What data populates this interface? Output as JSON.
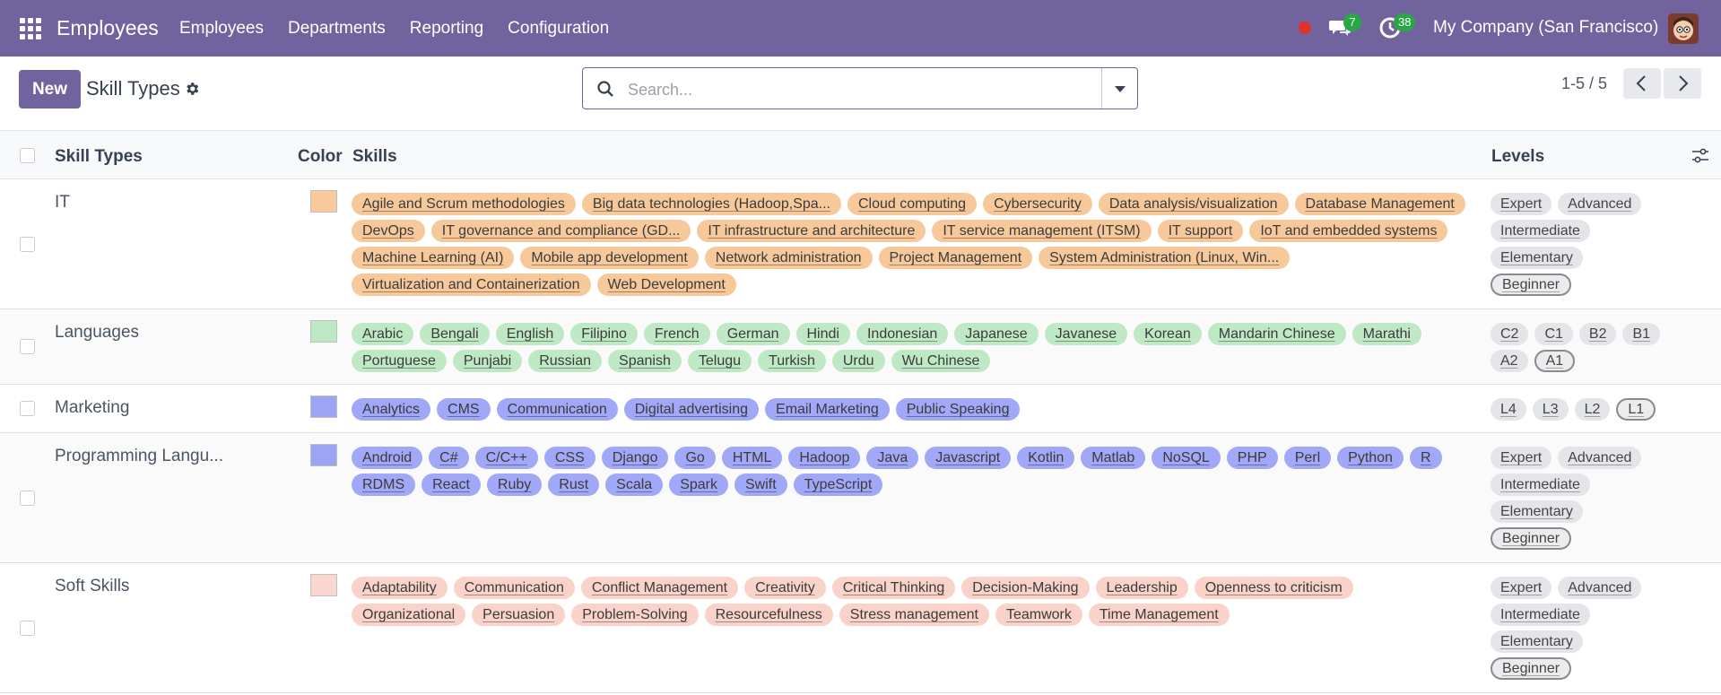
{
  "navbar": {
    "app_name": "Employees",
    "menu": [
      "Employees",
      "Departments",
      "Reporting",
      "Configuration"
    ],
    "chat_count": "7",
    "activity_count": "38",
    "company": "My Company (San Francisco)",
    "accent_color": "#71639e"
  },
  "control_panel": {
    "new_label": "New",
    "title": "Skill Types",
    "search_placeholder": "Search...",
    "pager": "1-5 / 5"
  },
  "list": {
    "headers": {
      "name": "Skill Types",
      "color": "Color",
      "skills": "Skills",
      "levels": "Levels"
    },
    "rows": [
      {
        "name": "IT",
        "color": "#f9c99c",
        "tag_color": "#f7c99a",
        "skills": [
          "Agile and Scrum methodologies",
          "Big data technologies (Hadoop,Spa...",
          "Cloud computing",
          "Cybersecurity",
          "Data analysis/visualization",
          "Database Management",
          "DevOps",
          "IT governance and compliance (GD...",
          "IT infrastructure and architecture",
          "IT service management (ITSM)",
          "IT support",
          "IoT and embedded systems",
          "Machine Learning (AI)",
          "Mobile app development",
          "Network administration",
          "Project Management",
          "System Administration (Linux, Win...",
          "Virtualization and Containerization",
          "Web Development"
        ],
        "levels": [
          "Expert",
          "Advanced",
          "Intermediate",
          "Elementary",
          "Beginner"
        ],
        "default_level": "Beginner"
      },
      {
        "name": "Languages",
        "color": "#bde8c4",
        "tag_color": "#bfe9c4",
        "skills": [
          "Arabic",
          "Bengali",
          "English",
          "Filipino",
          "French",
          "German",
          "Hindi",
          "Indonesian",
          "Japanese",
          "Javanese",
          "Korean",
          "Mandarin Chinese",
          "Marathi",
          "Portuguese",
          "Punjabi",
          "Russian",
          "Spanish",
          "Telugu",
          "Turkish",
          "Urdu",
          "Wu Chinese"
        ],
        "levels": [
          "C2",
          "C1",
          "B2",
          "B1",
          "A2",
          "A1"
        ],
        "default_level": "A1"
      },
      {
        "name": "Marketing",
        "color": "#9ba4f5",
        "tag_color": "#a0a8f7",
        "skills": [
          "Analytics",
          "CMS",
          "Communication",
          "Digital advertising",
          "Email Marketing",
          "Public Speaking"
        ],
        "levels": [
          "L4",
          "L3",
          "L2",
          "L1"
        ],
        "default_level": "L1"
      },
      {
        "name": "Programming Langu...",
        "color": "#9ba4f5",
        "tag_color": "#a0a8f7",
        "skills": [
          "Android",
          "C#",
          "C/C++",
          "CSS",
          "Django",
          "Go",
          "HTML",
          "Hadoop",
          "Java",
          "Javascript",
          "Kotlin",
          "Matlab",
          "NoSQL",
          "PHP",
          "Perl",
          "Python",
          "R",
          "RDMS",
          "React",
          "Ruby",
          "Rust",
          "Scala",
          "Spark",
          "Swift",
          "TypeScript"
        ],
        "levels": [
          "Expert",
          "Advanced",
          "Intermediate",
          "Elementary",
          "Beginner"
        ],
        "default_level": "Beginner"
      },
      {
        "name": "Soft Skills",
        "color": "#f9d6d0",
        "tag_color": "#f9d2c9",
        "skills": [
          "Adaptability",
          "Communication",
          "Conflict Management",
          "Creativity",
          "Critical Thinking",
          "Decision-Making",
          "Leadership",
          "Openness to criticism",
          "Organizational",
          "Persuasion",
          "Problem-Solving",
          "Resourcefulness",
          "Stress management",
          "Teamwork",
          "Time Management"
        ],
        "levels": [
          "Expert",
          "Advanced",
          "Intermediate",
          "Elementary",
          "Beginner"
        ],
        "default_level": "Beginner"
      }
    ]
  }
}
